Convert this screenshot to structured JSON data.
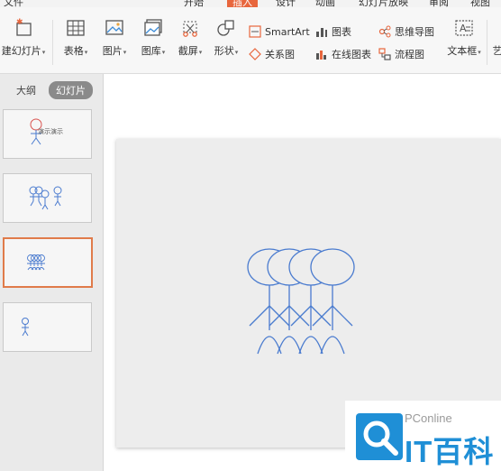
{
  "menu": {
    "items": [
      "文件",
      "开始",
      "插入",
      "设计",
      "动画",
      "幻灯片放映",
      "审阅",
      "视图"
    ],
    "active": "插入"
  },
  "ribbon": {
    "new_slide": "建幻灯片",
    "table": "表格",
    "picture": "图片",
    "gallery": "图库",
    "screenshot": "截屏",
    "shape": "形状",
    "smartart": "SmartArt",
    "chart": "图表",
    "mindmap": "思维导图",
    "relation": "关系图",
    "online_chart": "在线图表",
    "flowchart": "流程图",
    "textbox": "文本框",
    "more": "艺"
  },
  "panel": {
    "tab_outline": "大纲",
    "tab_slides": "幻灯片",
    "thumb1_caption": "演示演示"
  },
  "watermark": {
    "line1": "PConline",
    "line2": "IT百科"
  },
  "colors": {
    "accent": "#e8663d",
    "selection": "#e07b4a",
    "stroke": "#4a7bcf",
    "brand": "#1f8fd6"
  }
}
